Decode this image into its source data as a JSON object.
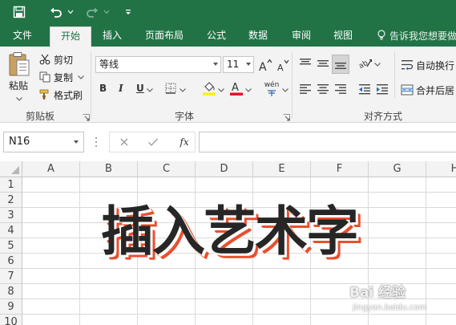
{
  "colors": {
    "excel_green": "#217346",
    "ribbon_bg": "#f3f3f3",
    "wordart_fill": "#262626",
    "wordart_shadow": "#e8502e",
    "font_color_underline": "#e81123",
    "highlight_underline": "#fff200"
  },
  "quick_access": {
    "icons": [
      "save-icon",
      "undo-icon",
      "redo-icon",
      "customize-icon"
    ]
  },
  "ribbon_tabs": [
    {
      "label": "文件",
      "active": false
    },
    {
      "label": "开始",
      "active": true
    },
    {
      "label": "插入",
      "active": false
    },
    {
      "label": "页面布局",
      "active": false
    },
    {
      "label": "公式",
      "active": false
    },
    {
      "label": "数据",
      "active": false
    },
    {
      "label": "审阅",
      "active": false
    },
    {
      "label": "视图",
      "active": false
    }
  ],
  "tell_me": "告诉我您想要做",
  "clipboard": {
    "paste": "粘贴",
    "cut": "剪切",
    "copy": "复制",
    "format_painter": "格式刷",
    "group_label": "剪贴板"
  },
  "font": {
    "font_name": "等线",
    "font_size": "11",
    "bold": "B",
    "italic": "I",
    "underline": "U",
    "phonetic": "wén",
    "group_label": "字体"
  },
  "alignment": {
    "wrap_text": "自动换行",
    "merge_center": "合并后居",
    "group_label": "对齐方式"
  },
  "formula_bar": {
    "name_box": "N16",
    "fx": "fx",
    "formula": ""
  },
  "sheet": {
    "columns": [
      "A",
      "B",
      "C",
      "D",
      "E",
      "F",
      "G",
      "H"
    ],
    "rows": [
      "1",
      "2",
      "3",
      "4",
      "5",
      "6",
      "7",
      "8",
      "9",
      "10"
    ]
  },
  "wordart": {
    "text": "插入艺术字"
  },
  "watermark": {
    "main": "Bai 经验",
    "sub": "jingyan.baidu.com"
  }
}
